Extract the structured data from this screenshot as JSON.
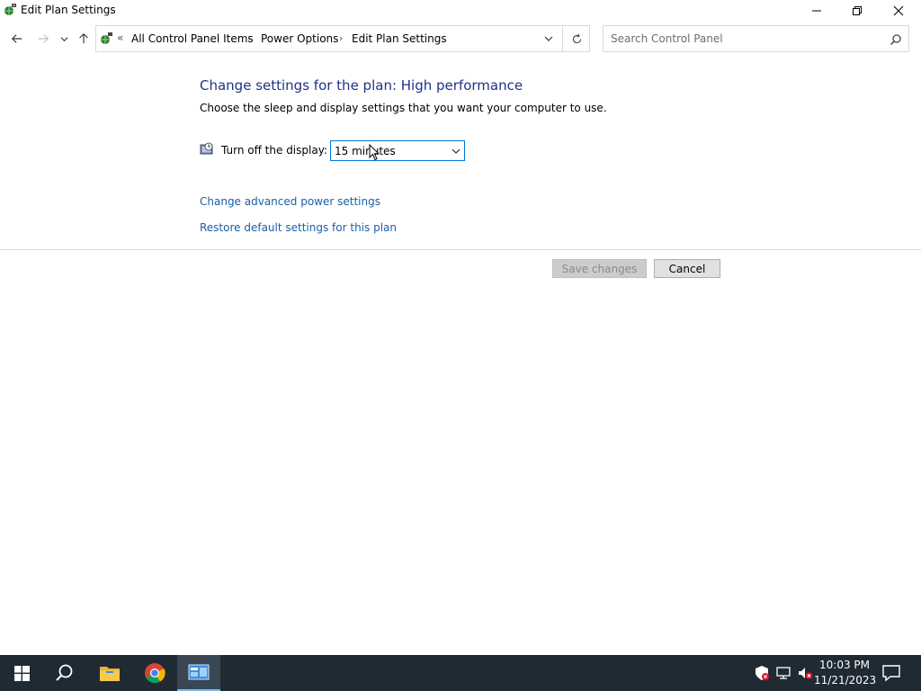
{
  "window": {
    "title": "Edit Plan Settings"
  },
  "address": {
    "overflow": "«",
    "crumbs": [
      "All Control Panel Items",
      "Power Options",
      "Edit Plan Settings"
    ],
    "separator": "›"
  },
  "search": {
    "placeholder": "Search Control Panel",
    "value": ""
  },
  "content": {
    "heading": "Change settings for the plan: High performance",
    "subheading": "Choose the sleep and display settings that you want your computer to use.",
    "display_label": "Turn off the display:",
    "display_value": "15 minutes",
    "link_advanced": "Change advanced power settings",
    "link_restore": "Restore default settings for this plan"
  },
  "buttons": {
    "save": "Save changes",
    "cancel": "Cancel"
  },
  "taskbar": {
    "time": "10:03 PM",
    "date": "11/21/2023",
    "apps": [
      "start-icon",
      "search-icon",
      "file-explorer-icon",
      "chrome-icon",
      "control-panel-icon"
    ]
  },
  "colors": {
    "heading": "#1e3287",
    "link": "#1a5fa8",
    "taskbar": "#1f2a33",
    "select_border": "#0078d7"
  }
}
